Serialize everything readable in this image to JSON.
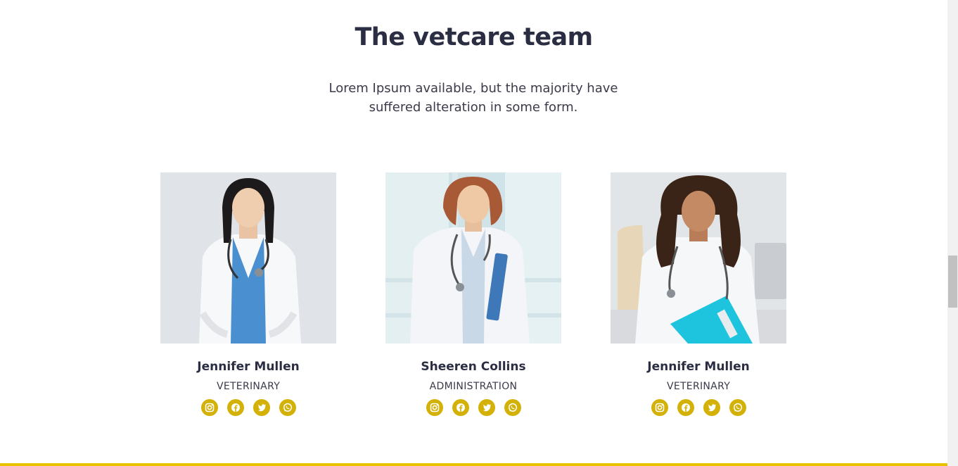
{
  "section": {
    "title": "The vetcare team",
    "subtitle": "Lorem Ipsum available, but the majority have suffered alteration in some form."
  },
  "team": [
    {
      "name": "Jennifer Mullen",
      "role": "VETERINARY"
    },
    {
      "name": "Sheeren Collins",
      "role": "ADMINISTRATION"
    },
    {
      "name": "Jennifer Mullen",
      "role": "VETERINARY"
    }
  ],
  "social_icons": [
    "instagram-icon",
    "facebook-icon",
    "twitter-icon",
    "whatsapp-icon"
  ],
  "colors": {
    "accent": "#d4b106",
    "heading": "#2b2d42",
    "footer_bar": "#e6c200"
  }
}
